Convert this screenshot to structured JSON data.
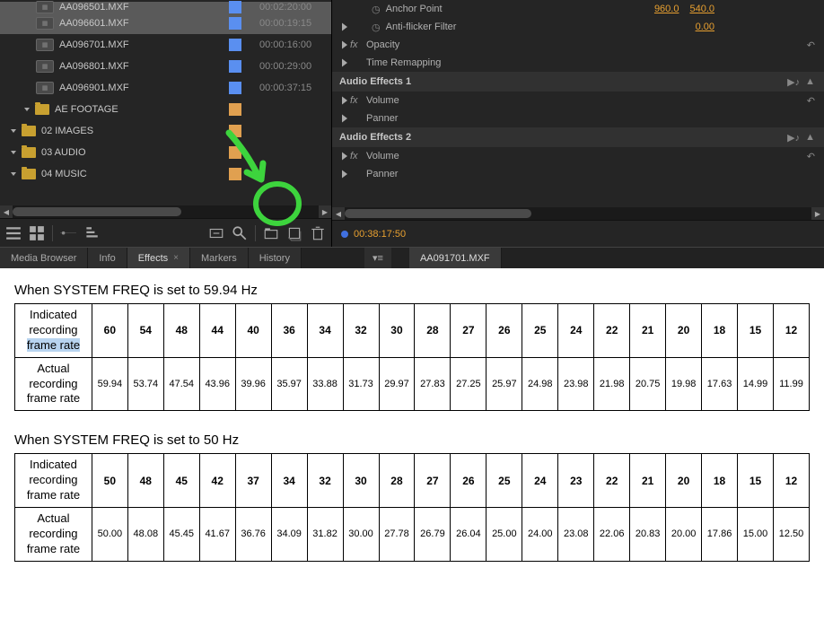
{
  "project": {
    "clips": [
      {
        "name": "AA096501.MXF",
        "duration": "00:02:20:00",
        "highlighted": true,
        "partial": true
      },
      {
        "name": "AA096601.MXF",
        "duration": "00:00:19:15",
        "highlighted": true
      },
      {
        "name": "AA096701.MXF",
        "duration": "00:00:16:00"
      },
      {
        "name": "AA096801.MXF",
        "duration": "00:00:29:00"
      },
      {
        "name": "AA096901.MXF",
        "duration": "00:00:37:15"
      }
    ],
    "folders": [
      {
        "name": "AE FOOTAGE",
        "level": 1
      },
      {
        "name": "02 IMAGES",
        "level": 0
      },
      {
        "name": "03 AUDIO",
        "level": 0
      },
      {
        "name": "04 MUSIC",
        "level": 0
      }
    ]
  },
  "effects": {
    "anchor_label": "Anchor Point",
    "anchor_x": "960.0",
    "anchor_y": "540.0",
    "antiflicker_label": "Anti-flicker Filter",
    "antiflicker_val": "0.00",
    "opacity": "Opacity",
    "time_remap": "Time Remapping",
    "audio1": "Audio Effects 1",
    "audio2": "Audio Effects 2",
    "volume": "Volume",
    "panner": "Panner"
  },
  "timecode": "00:38:17:50",
  "tabs": {
    "left": [
      "Media Browser",
      "Info",
      "Effects",
      "Markers",
      "History"
    ],
    "active_left": "Effects",
    "right": "AA091701.MXF"
  },
  "doc": {
    "heading1": "When SYSTEM FREQ is set to 59.94 Hz",
    "heading2": "When SYSTEM FREQ is set to 50 Hz",
    "row1_label": "Indicated recording frame rate",
    "row2_label": "Actual recording frame rate"
  },
  "chart_data": [
    {
      "type": "table",
      "title": "When SYSTEM FREQ is set to 59.94 Hz",
      "indicated": [
        60,
        54,
        48,
        44,
        40,
        36,
        34,
        32,
        30,
        28,
        27,
        26,
        25,
        24,
        22,
        21,
        20,
        18,
        15,
        12
      ],
      "actual": [
        59.94,
        53.74,
        47.54,
        43.96,
        39.96,
        35.97,
        33.88,
        31.73,
        29.97,
        27.83,
        27.25,
        25.97,
        24.98,
        23.98,
        21.98,
        20.75,
        19.98,
        17.63,
        14.99,
        11.99
      ]
    },
    {
      "type": "table",
      "title": "When SYSTEM FREQ is set to 50 Hz",
      "indicated": [
        50,
        48,
        45,
        42,
        37,
        34,
        32,
        30,
        28,
        27,
        26,
        25,
        24,
        23,
        22,
        21,
        20,
        18,
        15,
        12
      ],
      "actual": [
        50.0,
        48.08,
        45.45,
        41.67,
        36.76,
        34.09,
        31.82,
        30.0,
        27.78,
        26.79,
        26.04,
        25.0,
        24.0,
        23.08,
        22.06,
        20.83,
        20.0,
        17.86,
        15.0,
        12.5
      ]
    }
  ]
}
